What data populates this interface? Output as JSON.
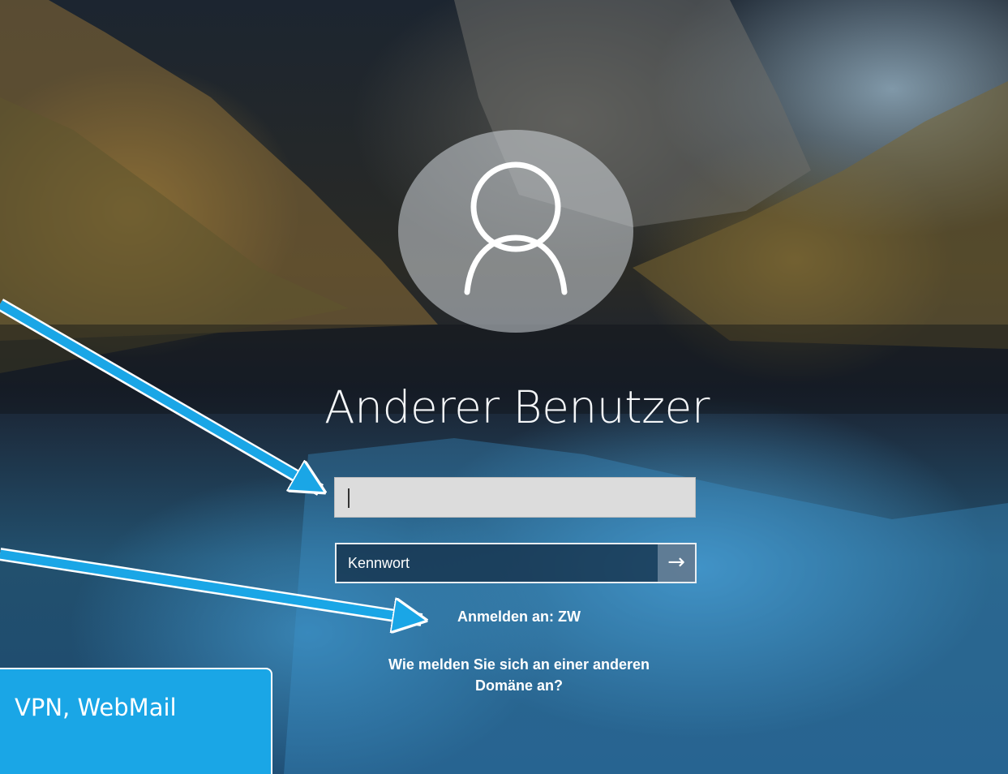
{
  "login": {
    "username": "Anderer Benutzer",
    "user_field_value": "",
    "password_placeholder": "Kennwort",
    "submit_glyph": "→",
    "domain_label": "Anmelden an: ZW",
    "other_domain_line1": "Wie melden Sie sich an einer anderen",
    "other_domain_line2": "Domäne an?"
  },
  "annotation": {
    "callout_text": "VPN, WebMail",
    "arrow_color": "#1aa6e6"
  },
  "icons": [
    "user-avatar-icon",
    "arrow-right-icon"
  ]
}
